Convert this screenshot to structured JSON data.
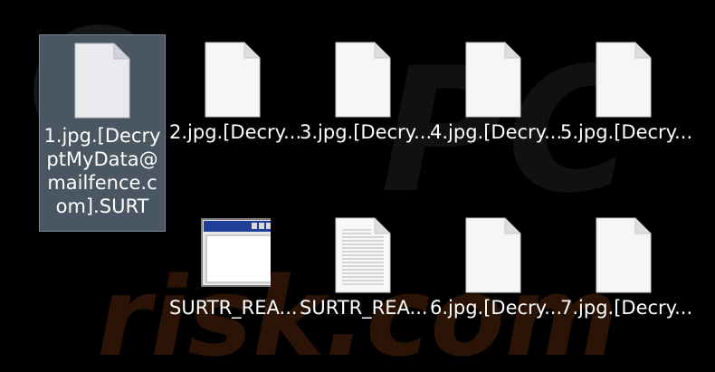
{
  "watermark": {
    "top_text": "PC",
    "bottom_text": "risk.com"
  },
  "files": [
    {
      "name": "1.jpg.[DecryptMyData@mailfence.com].SURT",
      "icon": "blank-file-icon",
      "selected": true
    },
    {
      "name": "2.jpg.[Decry...",
      "icon": "blank-file-icon",
      "selected": false
    },
    {
      "name": "3.jpg.[Decry...",
      "icon": "blank-file-icon",
      "selected": false
    },
    {
      "name": "4.jpg.[Decry...",
      "icon": "blank-file-icon",
      "selected": false
    },
    {
      "name": "5.jpg.[Decry...",
      "icon": "blank-file-icon",
      "selected": false
    },
    {
      "name": "SURTR_REA...",
      "icon": "window-app-icon",
      "selected": false
    },
    {
      "name": "SURTR_REA...",
      "icon": "text-file-icon",
      "selected": false
    },
    {
      "name": "6.jpg.[Decry...",
      "icon": "blank-file-icon",
      "selected": false
    },
    {
      "name": "7.jpg.[Decry...",
      "icon": "blank-file-icon",
      "selected": false
    }
  ],
  "colors": {
    "background": "#000000",
    "selection": "#4a5763",
    "label": "#ffffff"
  }
}
